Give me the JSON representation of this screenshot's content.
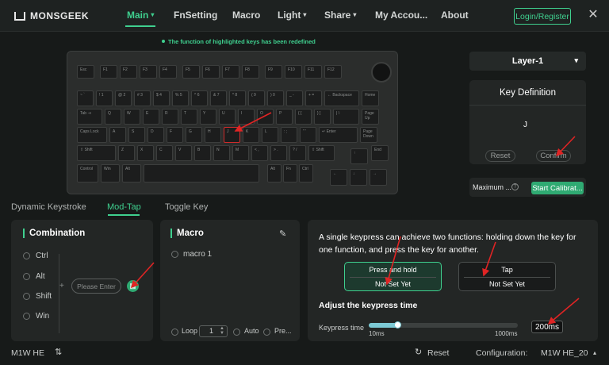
{
  "header": {
    "logo": "MONSGEEK",
    "nav": [
      {
        "label": "Main",
        "caret": "▾",
        "active": true
      },
      {
        "label": "FnSetting"
      },
      {
        "label": "Macro"
      },
      {
        "label": "Light",
        "caret": "▾"
      },
      {
        "label": "Share",
        "caret": "▾"
      },
      {
        "label": "My Accou..."
      },
      {
        "label": "About"
      }
    ],
    "login_label": "Login/Register",
    "close_glyph": "✕"
  },
  "notice": "The function of highlighted keys has been redefined",
  "keyboard": {
    "rows": [
      [
        "Esc",
        "F1",
        "F2",
        "F3",
        "F4",
        "F5",
        "F6",
        "F7",
        "F8",
        "F9",
        "F10",
        "F11",
        "F12"
      ],
      [
        "~ `",
        "! 1",
        "@ 2",
        "# 3",
        "$ 4",
        "% 5",
        "^ 6",
        "& 7",
        "* 8",
        "( 9",
        ") 0",
        "_ -",
        "+ =",
        "← Backspace",
        "Home"
      ],
      [
        "Tab ⇥",
        "Q",
        "W",
        "E",
        "R",
        "T",
        "Y",
        "U",
        "I",
        "O",
        "P",
        "{ [",
        "} ]",
        "| \\",
        "Page Up"
      ],
      [
        "Caps Lock",
        "A",
        "S",
        "D",
        "F",
        "G",
        "H",
        "J",
        "K",
        "L",
        ": ;",
        "\" '",
        "↵ Enter",
        "Page Down"
      ],
      [
        "⇧ Shift",
        "Z",
        "X",
        "C",
        "V",
        "B",
        "N",
        "M",
        "< ,",
        "> .",
        "? /",
        "⇧ Shift",
        "↑",
        "End"
      ],
      [
        "Control",
        "Win",
        "Alt",
        "",
        "Alt",
        "Fn",
        "Ctrl",
        "←",
        "↓",
        "→"
      ]
    ],
    "selected_key": "J"
  },
  "layer": {
    "label": "Layer-1",
    "caret": "▾"
  },
  "key_definition": {
    "title": "Key Definition",
    "value": "J",
    "reset_label": "Reset",
    "confirm_label": "Confirm"
  },
  "calibration": {
    "label": "Maximum ...",
    "help_glyph": "?",
    "button_label": "Start Calibrat..."
  },
  "mode_tabs": [
    {
      "label": "Dynamic Keystroke"
    },
    {
      "label": "Mod-Tap",
      "active": true
    },
    {
      "label": "Toggle Key"
    }
  ],
  "combination": {
    "title": "Combination",
    "options": [
      "Ctrl",
      "Alt",
      "Shift",
      "Win"
    ],
    "plus": "+",
    "input_placeholder": "Please Enter",
    "grid_glyph": "▦"
  },
  "macro_panel": {
    "title": "Macro",
    "edit_glyph": "✎",
    "items": [
      "macro 1"
    ],
    "loop_label": "Loop",
    "loop_value": "1",
    "auto_label": "Auto",
    "press_label": "Pre..."
  },
  "modtap": {
    "description": "A single keypress can achieve two functions: holding down the key for one function, and press the key for another.",
    "hold": {
      "label": "Press and hold",
      "value": "Not Set Yet"
    },
    "tap": {
      "label": "Tap",
      "value": "Not Set Yet"
    },
    "adjust_title": "Adjust the keypress time",
    "keypress_label": "Keypress time",
    "min_label": "10ms",
    "max_label": "1000ms",
    "min": 10,
    "max": 1000,
    "time": 200,
    "value_label": "200ms"
  },
  "footer": {
    "device": "M1W HE",
    "tune_glyph": "⇅",
    "reset_glyph": "↻",
    "reset_label": "Reset",
    "config_label": "Configuration:",
    "config_value": "M1W HE_20",
    "config_caret": "▴"
  },
  "colors": {
    "accent": "#3fd08f",
    "selected_key_border": "#d02b2b",
    "annotation_arrow": "#e02424"
  }
}
